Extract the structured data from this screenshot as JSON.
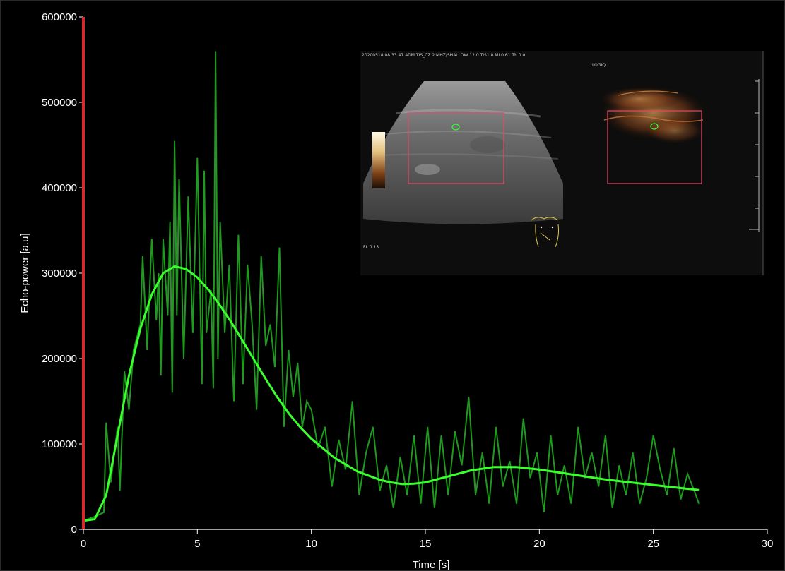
{
  "chart_data": {
    "type": "line",
    "xlabel": "Time [s]",
    "ylabel": "Echo-power [a.u]",
    "xlim": [
      0,
      30
    ],
    "ylim": [
      0,
      600000
    ],
    "x_ticks": [
      "0",
      "5",
      "10",
      "15",
      "20",
      "25",
      "30"
    ],
    "y_ticks": [
      "0",
      "100000",
      "200000",
      "300000",
      "400000",
      "500000",
      "600000"
    ],
    "grid": false,
    "colors": {
      "raw": "#1f9a1f",
      "fit": "#39ff2c",
      "marker": "#d9262b",
      "axis": "#ffffff",
      "roi": "#e24b6a"
    },
    "marker_x": 0,
    "series": [
      {
        "style": "raw-noisy",
        "x": [
          0,
          0.5,
          0.9,
          1.0,
          1.2,
          1.5,
          1.6,
          1.8,
          2.0,
          2.2,
          2.5,
          2.6,
          2.8,
          3.0,
          3.2,
          3.3,
          3.4,
          3.5,
          3.7,
          3.8,
          3.9,
          4.0,
          4.1,
          4.2,
          4.4,
          4.6,
          4.8,
          5.0,
          5.2,
          5.3,
          5.4,
          5.6,
          5.7,
          5.8,
          5.9,
          6.0,
          6.2,
          6.4,
          6.6,
          6.8,
          7.0,
          7.2,
          7.4,
          7.6,
          7.8,
          8.0,
          8.2,
          8.4,
          8.6,
          8.8,
          9.0,
          9.2,
          9.4,
          9.6,
          9.8,
          10.0,
          10.3,
          10.6,
          10.9,
          11.2,
          11.5,
          11.8,
          12.1,
          12.4,
          12.7,
          13.0,
          13.3,
          13.6,
          13.9,
          14.2,
          14.5,
          14.8,
          15.1,
          15.4,
          15.7,
          16.0,
          16.3,
          16.6,
          16.9,
          17.2,
          17.5,
          17.8,
          18.1,
          18.4,
          18.7,
          19.0,
          19.3,
          19.6,
          19.9,
          20.2,
          20.5,
          20.8,
          21.1,
          21.4,
          21.7,
          22.0,
          22.3,
          22.6,
          22.9,
          23.2,
          23.5,
          23.8,
          24.1,
          24.4,
          24.7,
          25.0,
          25.3,
          25.6,
          25.9,
          26.2,
          26.5,
          26.8,
          27.0
        ],
        "values": [
          10000,
          15000,
          20000,
          125000,
          55000,
          120000,
          45000,
          185000,
          140000,
          210000,
          240000,
          320000,
          210000,
          340000,
          245000,
          300000,
          180000,
          340000,
          250000,
          360000,
          160000,
          455000,
          250000,
          410000,
          200000,
          390000,
          230000,
          435000,
          170000,
          420000,
          230000,
          280000,
          165000,
          560000,
          200000,
          360000,
          230000,
          310000,
          150000,
          345000,
          170000,
          310000,
          240000,
          140000,
          320000,
          215000,
          240000,
          190000,
          330000,
          120000,
          210000,
          155000,
          195000,
          120000,
          150000,
          140000,
          95000,
          120000,
          50000,
          105000,
          70000,
          150000,
          40000,
          90000,
          120000,
          45000,
          75000,
          25000,
          85000,
          40000,
          110000,
          30000,
          120000,
          25000,
          110000,
          40000,
          115000,
          75000,
          155000,
          40000,
          90000,
          30000,
          120000,
          50000,
          80000,
          30000,
          130000,
          60000,
          90000,
          20000,
          110000,
          40000,
          75000,
          30000,
          120000,
          60000,
          90000,
          50000,
          110000,
          25000,
          75000,
          40000,
          90000,
          30000,
          60000,
          110000,
          70000,
          40000,
          95000,
          35000,
          65000,
          45000,
          30000
        ]
      },
      {
        "style": "fit-smooth",
        "x": [
          0,
          0.5,
          1.0,
          1.5,
          2.0,
          2.5,
          3.0,
          3.5,
          4.0,
          4.5,
          5.0,
          5.5,
          6.0,
          6.5,
          7.0,
          7.5,
          8.0,
          8.5,
          9.0,
          9.5,
          10.0,
          11.0,
          12.0,
          13.0,
          13.5,
          14.0,
          14.5,
          15.0,
          16.0,
          17.0,
          18.0,
          19.0,
          20.0,
          21.0,
          22.0,
          23.0,
          24.0,
          25.0,
          26.0,
          27.0
        ],
        "values": [
          10000,
          12000,
          40000,
          110000,
          180000,
          235000,
          275000,
          300000,
          308000,
          305000,
          295000,
          280000,
          262000,
          242000,
          220000,
          198000,
          176000,
          155000,
          136000,
          120000,
          106000,
          84000,
          68000,
          58000,
          55000,
          53000,
          53500,
          55000,
          62000,
          69000,
          73000,
          73000,
          70000,
          66000,
          62000,
          58000,
          55000,
          52000,
          49000,
          46000
        ]
      }
    ]
  },
  "inset": {
    "header_text": "20200518 08.33.47 ADM TIS_CZ 2 MHZ/SHALLOW 12.0 TIS1.8 MI 0.61 Tb 0.0",
    "brand_label": "LOGIQ",
    "footer_label": "FL 0.13",
    "colors": {
      "background": "#111111",
      "ultrasound": "#6e6e6e",
      "contrast": "#c9773c",
      "roi_box": "#e24b6a",
      "roi_circle": "#3cff3c",
      "body_mark": "#e1c94e"
    }
  }
}
